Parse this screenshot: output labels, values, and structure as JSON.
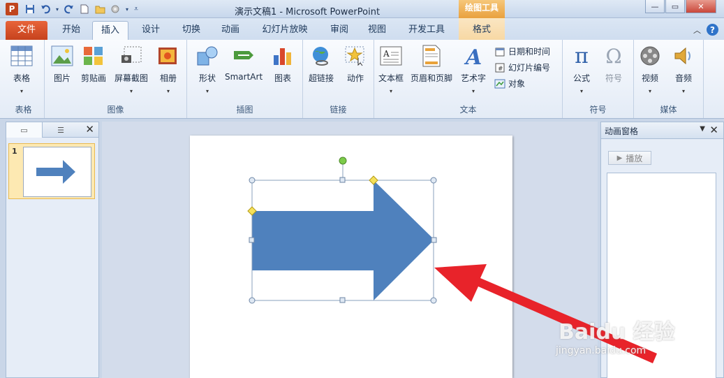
{
  "window": {
    "app_icon": "P",
    "title": "演示文稿1 - Microsoft PowerPoint",
    "context_tool": "绘图工具",
    "controls": {
      "minimize": "—",
      "restore": "▭",
      "close": "✕"
    }
  },
  "qat_icons": [
    "save-icon",
    "undo-icon",
    "redo-icon",
    "new-icon",
    "open-icon",
    "more-icon"
  ],
  "tabs": {
    "file": "文件",
    "items": [
      "开始",
      "插入",
      "设计",
      "切换",
      "动画",
      "幻灯片放映",
      "审阅",
      "视图",
      "开发工具",
      "格式"
    ],
    "active": "插入"
  },
  "ribbon": {
    "groups": {
      "tables": "表格",
      "images": "图像",
      "illustrations": "插图",
      "links": "链接",
      "text": "文本",
      "symbols": "符号",
      "media": "媒体"
    },
    "buttons": {
      "table": "表格",
      "picture": "图片",
      "clipart": "剪贴画",
      "screenshot": "屏幕截图",
      "album": "相册",
      "shapes": "形状",
      "smartart": "SmartArt",
      "chart": "图表",
      "hyperlink": "超链接",
      "action": "动作",
      "textbox": "文本框",
      "header_footer": "页眉和页脚",
      "wordart": "艺术字",
      "datetime": "日期和时间",
      "slide_number": "幻灯片编号",
      "object": "对象",
      "equation": "公式",
      "symbol": "符号",
      "video": "视频",
      "audio": "音频"
    }
  },
  "slides_pane": {
    "slide_number": "1"
  },
  "animation_pane": {
    "title": "动画窗格",
    "play": "播放"
  },
  "watermark": {
    "brand": "Baidu 经验",
    "url": "jingyan.baidu.com"
  },
  "colors": {
    "shape_fill": "#4f81bd",
    "arrow_annotation": "#e8232a",
    "file_tab": "#d24726",
    "context_tab": "#f0a94c"
  }
}
